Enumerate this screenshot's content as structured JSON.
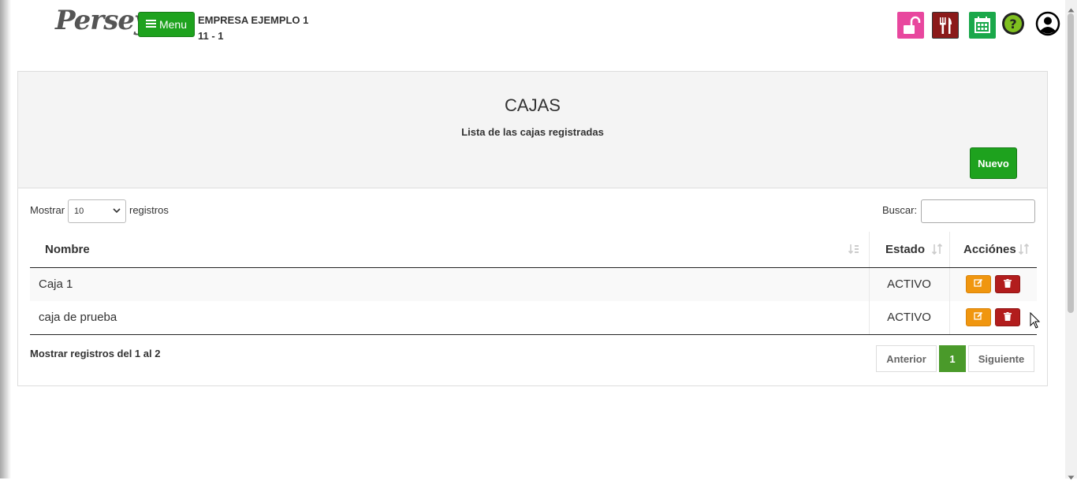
{
  "header": {
    "logo_text": "Persey",
    "menu_label": "Menu",
    "company_name": "EMPRESA EJEMPLO 1",
    "company_code": "11 - 1"
  },
  "top_icons": [
    {
      "name": "unlock-icon",
      "color": "#e8479e"
    },
    {
      "name": "restaurant-icon",
      "color": "#8b1a1a"
    },
    {
      "name": "calendar-icon",
      "color": "#1aa84a"
    },
    {
      "name": "help-icon",
      "color": "#7fbf1f"
    },
    {
      "name": "user-account-icon",
      "color": "#000000"
    }
  ],
  "page": {
    "title": "CAJAS",
    "subtitle": "Lista de las cajas registradas",
    "new_button": "Nuevo"
  },
  "table_controls": {
    "show_label": "Mostrar",
    "page_size": "10",
    "records_label": "registros",
    "search_label": "Buscar:",
    "search_value": ""
  },
  "table": {
    "columns": [
      "Nombre",
      "Estado",
      "Acciónes"
    ],
    "rows": [
      {
        "nombre": "Caja 1",
        "estado": "ACTIVO"
      },
      {
        "nombre": "caja de prueba",
        "estado": "ACTIVO"
      }
    ]
  },
  "footer": {
    "info": "Mostrar registros del 1 al 2",
    "prev": "Anterior",
    "current_page": "1",
    "next": "Siguiente"
  },
  "colors": {
    "primary_green": "#1ea21e",
    "edit_orange": "#f0960f",
    "delete_red": "#b21d1d",
    "page_active": "#4a9a2a"
  }
}
